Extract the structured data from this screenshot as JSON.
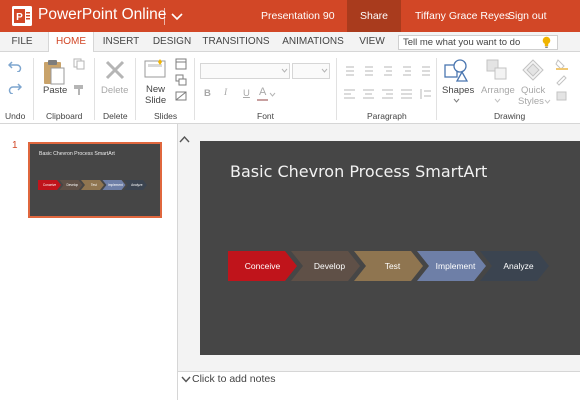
{
  "titlebar": {
    "app_name": "PowerPoint Online",
    "document_name": "Presentation 90",
    "share_label": "Share",
    "user_name": "Tiffany Grace Reyes",
    "sign_out_label": "Sign out",
    "logo_letter": "P",
    "accent_color": "#d24726"
  },
  "tabs": {
    "file": "FILE",
    "home": "HOME",
    "insert": "INSERT",
    "design": "DESIGN",
    "transitions": "TRANSITIONS",
    "animations": "ANIMATIONS",
    "view": "VIEW",
    "active": "HOME"
  },
  "tell_me": {
    "placeholder": "Tell me what you want to do",
    "icon": "lightbulb-icon"
  },
  "ribbon": {
    "undo_group": "Undo",
    "clipboard_group": "Clipboard",
    "paste_label": "Paste",
    "delete_label": "Delete",
    "delete_group": "Delete",
    "new_slide_line1": "New",
    "new_slide_line2": "Slide",
    "slides_group": "Slides",
    "font_group": "Font",
    "paragraph_group": "Paragraph",
    "shapes_label": "Shapes",
    "arrange_label": "Arrange",
    "quick_styles_line1": "Quick",
    "quick_styles_line2": "Styles",
    "drawing_group": "Drawing",
    "font_buttons": [
      "B",
      "I",
      "U",
      "A"
    ]
  },
  "slides_pane": {
    "slide_number": "1",
    "thumb_title": "Basic Chevron Process SmartArt",
    "thumb_steps": [
      "Conceive",
      "Develop",
      "Test",
      "Implement",
      "Analyze"
    ]
  },
  "slide": {
    "title": "Basic Chevron Process SmartArt",
    "steps": [
      "Conceive",
      "Develop",
      "Test",
      "Implement",
      "Analyze"
    ],
    "step_colors": [
      "#c0141b",
      "#5f5047",
      "#8f7550",
      "#6e7fa7",
      "#3b4450"
    ],
    "background_color": "#464646"
  },
  "notes": {
    "placeholder": "Click to add notes"
  }
}
